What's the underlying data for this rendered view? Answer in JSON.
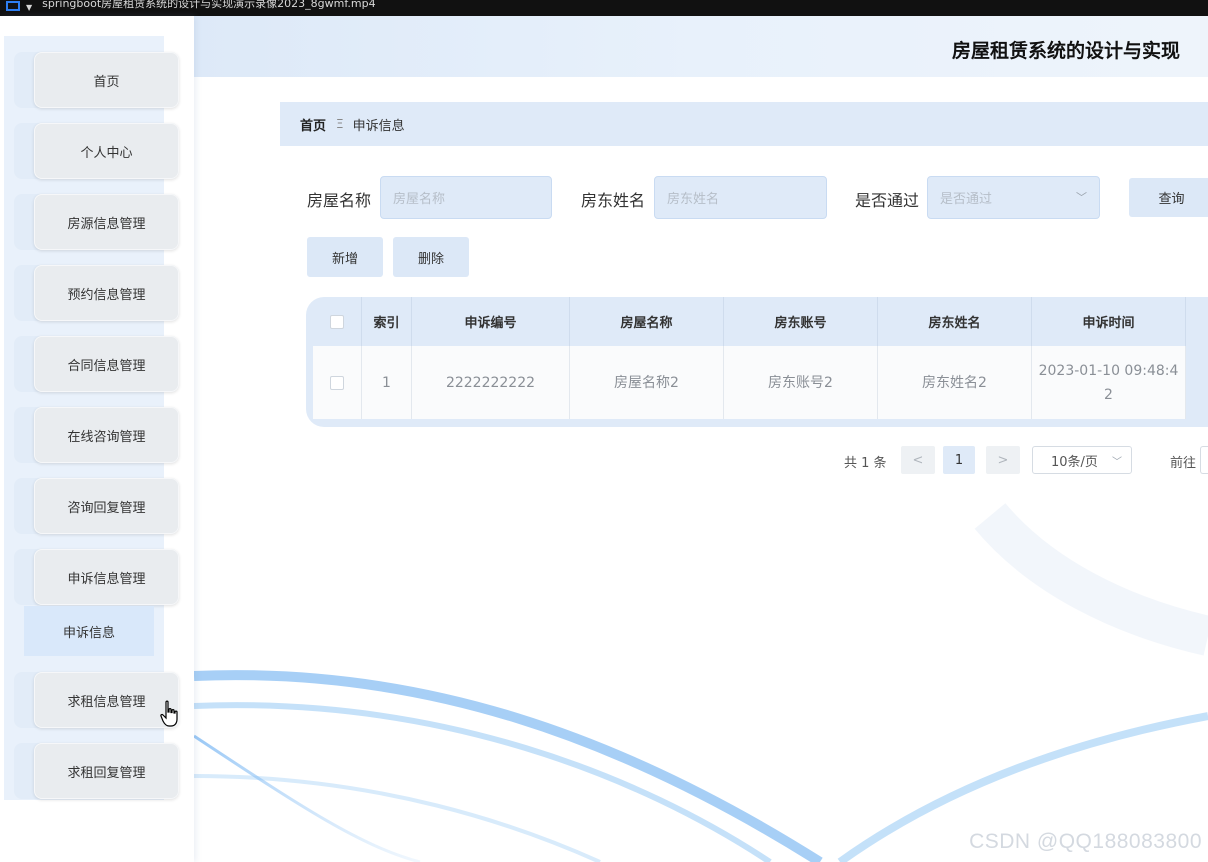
{
  "window": {
    "title": "springboot房屋租赁系统的设计与实现演示录像2023_8gwmf.mp4"
  },
  "header": {
    "title": "房屋租赁系统的设计与实现"
  },
  "sidebar": {
    "items": [
      {
        "label": "首页"
      },
      {
        "label": "个人中心"
      },
      {
        "label": "房源信息管理"
      },
      {
        "label": "预约信息管理"
      },
      {
        "label": "合同信息管理"
      },
      {
        "label": "在线咨询管理"
      },
      {
        "label": "咨询回复管理"
      },
      {
        "label": "申诉信息管理"
      },
      {
        "label": "求租信息管理"
      },
      {
        "label": "求租回复管理"
      }
    ],
    "submenu": {
      "label": "申诉信息"
    }
  },
  "breadcrumb": {
    "home": "首页",
    "separator": "Ξ",
    "current": "申诉信息"
  },
  "search": {
    "house_name_label": "房屋名称",
    "house_name_placeholder": "房屋名称",
    "landlord_name_label": "房东姓名",
    "landlord_name_placeholder": "房东姓名",
    "approved_label": "是否通过",
    "approved_placeholder": "是否通过",
    "query_label": "查询"
  },
  "actions": {
    "add_label": "新增",
    "delete_label": "删除"
  },
  "table": {
    "columns": [
      "索引",
      "申诉编号",
      "房屋名称",
      "房东账号",
      "房东姓名",
      "申诉时间"
    ],
    "rows": [
      {
        "index": "1",
        "complaint_no": "2222222222",
        "house_name": "房屋名称2",
        "landlord_account": "房东账号2",
        "landlord_name": "房东姓名2",
        "complaint_time_line1": "2023-01-10 09:48:4",
        "complaint_time_line2": "2"
      }
    ]
  },
  "pagination": {
    "total_text": "共 1 条",
    "prev": "<",
    "current_page": "1",
    "next": ">",
    "page_size": "10条/页",
    "goto_label": "前往"
  },
  "watermark": "CSDN @QQ188083800",
  "colors": {
    "accent_light": "#dfeaf8",
    "sidebar_face": "#e9ecef"
  }
}
